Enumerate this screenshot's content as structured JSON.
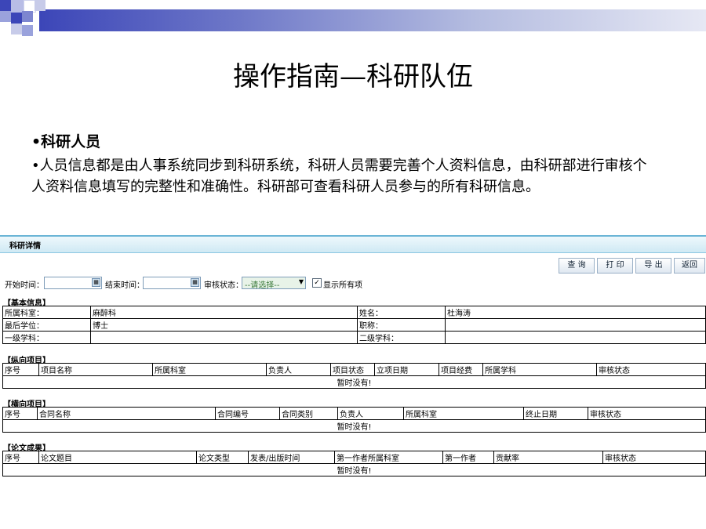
{
  "slide": {
    "title": "操作指南—科研队伍",
    "bullet_heading": "•科研人员",
    "paragraph": "•人员信息都是由人事系统同步到科研系统，科研人员需要完善个人资料信息，由科研部进行审核个人资料信息填写的完整性和准确性。科研部可查看科研人员参与的所有科研信息。"
  },
  "app": {
    "header_title": "科研详情",
    "buttons": {
      "query": "查 询",
      "print": "打 印",
      "export": "导 出",
      "back": "返回"
    },
    "filters": {
      "start_label": "开始时间：",
      "end_label": "结束时间：",
      "status_label": "审核状态：",
      "status_value": "--请选择--",
      "show_all_label": "显示所有项",
      "show_all_checked": true
    },
    "basic": {
      "section_title": "【基本信息】",
      "dept_label": "所属科室：",
      "dept_value": "麻醉科",
      "name_label": "姓名：",
      "name_value": "杜海涛",
      "degree_label": "最后学位：",
      "degree_value": "博士",
      "title_label": "职称：",
      "title_value": "",
      "subject1_label": "一级学科：",
      "subject1_value": "",
      "subject2_label": "二级学科：",
      "subject2_value": ""
    },
    "vertical": {
      "section_title": "【纵向项目】",
      "columns": [
        "序号",
        "项目名称",
        "所属科室",
        "负责人",
        "项目状态",
        "立项日期",
        "项目经费",
        "所属学科",
        "审核状态"
      ],
      "empty_text": "暂时没有!"
    },
    "horizontal": {
      "section_title": "【横向项目】",
      "columns": [
        "序号",
        "合同名称",
        "合同编号",
        "合同类别",
        "负责人",
        "所属科室",
        "终止日期",
        "审核状态"
      ],
      "empty_text": "暂时没有!"
    },
    "papers": {
      "section_title": "【论文成果】",
      "columns": [
        "序号",
        "论文题目",
        "论文类型",
        "发表/出版时间",
        "第一作者所属科室",
        "第一作者",
        "贡献率",
        "审核状态"
      ],
      "empty_text": "暂时没有!"
    }
  },
  "colors": {
    "band_dark": "#3c46b8",
    "band_light": "#e6e8f4",
    "app_header": "#cfe9f4"
  },
  "icons": [
    "calendar-icon",
    "dropdown-arrow-icon",
    "checkbox-checked-icon"
  ]
}
